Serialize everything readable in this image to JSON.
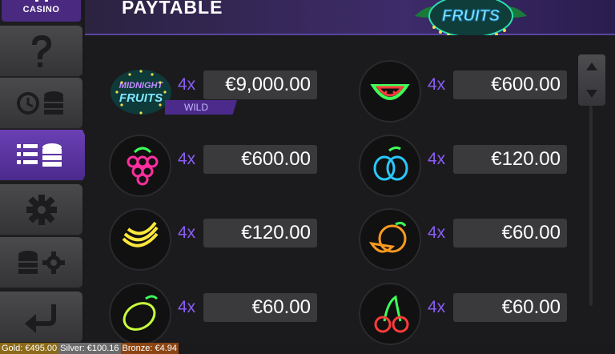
{
  "sidebar": {
    "logo_text": "CASINO",
    "buttons": [
      {
        "icon": "help-icon"
      },
      {
        "icon": "history-icon"
      },
      {
        "icon": "paytable-icon"
      },
      {
        "icon": "settings-icon"
      },
      {
        "icon": "bet-settings-icon"
      },
      {
        "icon": "back-icon"
      }
    ]
  },
  "header": {
    "title": "PAYTABLE",
    "logo": "Midnight Fruits"
  },
  "paytable": {
    "rows": [
      {
        "symbol": "midnight-fruits-logo",
        "symbol_text": [
          "MIDNIGHT",
          "FRUITS"
        ],
        "multiplier": "4x",
        "payout": "€9,000.00",
        "badge": "WILD"
      },
      {
        "symbol": "watermelon-icon",
        "multiplier": "4x",
        "payout": "€600.00"
      },
      {
        "symbol": "grapes-icon",
        "multiplier": "4x",
        "payout": "€600.00"
      },
      {
        "symbol": "plum-icon",
        "multiplier": "4x",
        "payout": "€120.00"
      },
      {
        "symbol": "banana-icon",
        "multiplier": "4x",
        "payout": "€120.00"
      },
      {
        "symbol": "orange-icon",
        "multiplier": "4x",
        "payout": "€60.00"
      },
      {
        "symbol": "lemon-icon",
        "multiplier": "4x",
        "payout": "€60.00"
      },
      {
        "symbol": "cherries-icon",
        "multiplier": "4x",
        "payout": "€60.00"
      }
    ]
  },
  "jackpots": {
    "gold": "Gold: €495.00",
    "silver": "Silver: €100.16",
    "bronze": "Bronze: €4.94"
  },
  "colors": {
    "accent": "#8b5cf6",
    "active_button": "#5b36a0"
  }
}
